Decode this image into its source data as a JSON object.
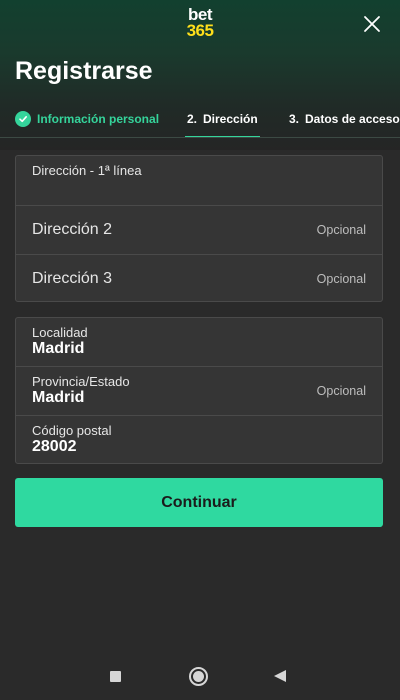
{
  "brand": {
    "logo_line1": "bet",
    "logo_line2": "365"
  },
  "header": {
    "title": "Registrarse",
    "close_icon": "close-icon"
  },
  "stepper": {
    "steps": [
      {
        "label": "Información personal",
        "status": "completed"
      },
      {
        "number": "2.",
        "label": "Dirección",
        "status": "active"
      },
      {
        "number": "3.",
        "label": "Datos de acceso",
        "status": "pending"
      }
    ]
  },
  "address_card": {
    "line1": {
      "label": "Dirección - 1ª línea",
      "value": ""
    },
    "line2": {
      "placeholder": "Dirección 2",
      "optional": "Opcional"
    },
    "line3": {
      "placeholder": "Dirección 3",
      "optional": "Opcional"
    }
  },
  "location_card": {
    "city": {
      "label": "Localidad",
      "value": "Madrid"
    },
    "province": {
      "label": "Provincia/Estado",
      "value": "Madrid",
      "optional": "Opcional"
    },
    "postal": {
      "label": "Código postal",
      "value": "28002"
    }
  },
  "actions": {
    "continue_label": "Continuar"
  },
  "colors": {
    "accent": "#35d49b",
    "button": "#2fd9a0",
    "brand_yellow": "#ffdf1b",
    "background": "#2a2a2a"
  },
  "system_nav": {
    "icons": [
      "recent-apps-icon",
      "home-icon",
      "back-icon"
    ]
  }
}
